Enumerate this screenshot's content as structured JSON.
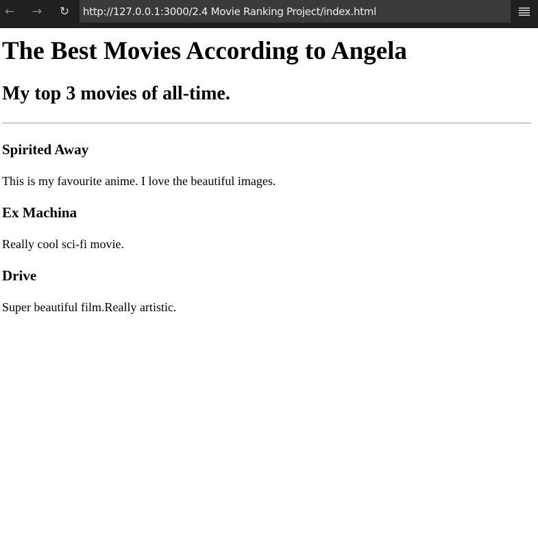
{
  "browser": {
    "back_icon": "←",
    "forward_icon": "→",
    "reload_icon": "↻",
    "url": "http://127.0.0.1:3000/2.4 Movie Ranking Project/index.html"
  },
  "page": {
    "title": "The Best Movies According to Angela",
    "subtitle": "My top 3 movies of all-time.",
    "movies": [
      {
        "title": "Spirited Away",
        "description": "This is my favourite anime. I love the beautiful images."
      },
      {
        "title": "Ex Machina",
        "description": "Really cool sci-fi movie."
      },
      {
        "title": "Drive",
        "description": "Super beautiful film.Really artistic."
      }
    ]
  }
}
